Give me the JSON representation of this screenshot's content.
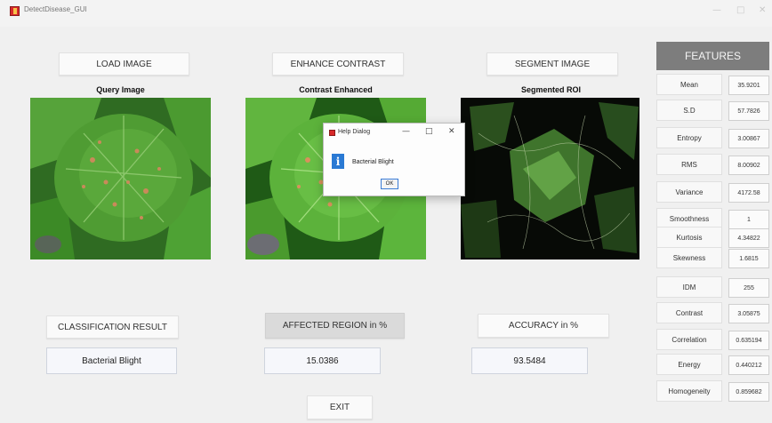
{
  "window": {
    "title": "DetectDisease_GUI",
    "minimize_glyph": "—",
    "maximize_glyph": "□",
    "close_glyph": "✕"
  },
  "buttons": {
    "load_image": "LOAD IMAGE",
    "enhance_contrast": "ENHANCE CONTRAST",
    "segment_image": "SEGMENT IMAGE",
    "exit": "EXIT"
  },
  "panels": {
    "query_caption": "Query Image",
    "contrast_caption": "Contrast Enhanced",
    "segmented_caption": "Segmented ROI"
  },
  "results": {
    "classification_label": "CLASSIFICATION RESULT",
    "classification_value": "Bacterial Blight",
    "affected_label": "AFFECTED REGION in %",
    "affected_value": "15.0386",
    "accuracy_label": "ACCURACY in %",
    "accuracy_value": "93.5484"
  },
  "features": {
    "header": "FEATURES",
    "items": [
      {
        "label": "Mean",
        "value": "35.9201"
      },
      {
        "label": "S.D",
        "value": "57.7826"
      },
      {
        "label": "Entropy",
        "value": "3.00867"
      },
      {
        "label": "RMS",
        "value": "8.00902"
      },
      {
        "label": "Variance",
        "value": "4172.58"
      },
      {
        "label": "Smoothness",
        "value": "1"
      },
      {
        "label": "Kurtosis",
        "value": "4.34822"
      },
      {
        "label": "Skewness",
        "value": "1.6815"
      },
      {
        "label": "IDM",
        "value": "255"
      },
      {
        "label": "Contrast",
        "value": "3.05875"
      },
      {
        "label": "Correlation",
        "value": "0.635194"
      },
      {
        "label": "Energy",
        "value": "0.440212"
      },
      {
        "label": "Homogeneity",
        "value": "0.859682"
      }
    ]
  },
  "dialog": {
    "title": "Help Dialog",
    "message": "Bacterial Blight",
    "ok": "OK",
    "minimize_glyph": "—",
    "maximize_glyph": "□",
    "close_glyph": "✕"
  },
  "colors": {
    "features_header_bg": "#7d7d7d",
    "affected_label_bg": "#dadada",
    "info_icon": "#2a7ad4",
    "leaf_green": "#3f8f2a",
    "blight_spots": "#c98a5a"
  }
}
